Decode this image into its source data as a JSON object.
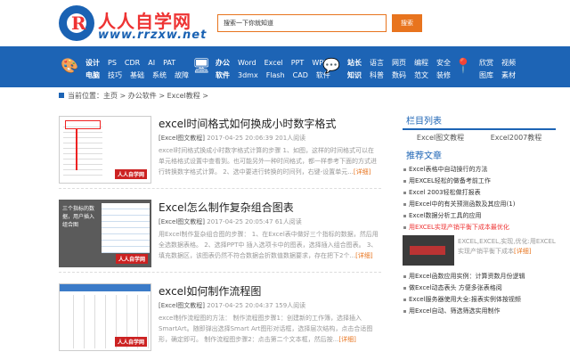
{
  "logo": {
    "mark": "R",
    "name": "人人自学网",
    "url": "www.rrzxw.net"
  },
  "search": {
    "value": "搜索一下你就知道",
    "button": "搜索"
  },
  "nav": {
    "groups": [
      {
        "icon": "palette-icon",
        "glyph": "🎨",
        "row1": [
          "设计",
          "PS",
          "CDR",
          "AI",
          "PAT"
        ],
        "row2": [
          "电脑",
          "技巧",
          "基础",
          "系统",
          "故障"
        ]
      },
      {
        "icon": "monitor-icon",
        "glyph": "🖥",
        "row1": [
          "办公",
          "Word",
          "Excel",
          "PPT",
          "WPS"
        ],
        "row2": [
          "软件",
          "3dmx",
          "Flash",
          "CAD",
          "软件"
        ]
      },
      {
        "icon": "chat-icon",
        "glyph": "💬",
        "row1": [
          "站长",
          "语言",
          "网页",
          "编程",
          "安全"
        ],
        "row2": [
          "知识",
          "科普",
          "数码",
          "范文",
          "装修"
        ]
      },
      {
        "icon": "location-icon",
        "glyph": "📍",
        "row1": [
          "欣赏",
          "视频"
        ],
        "row2": [
          "图库",
          "素材"
        ]
      }
    ]
  },
  "breadcrumb": {
    "label": "当前位置：",
    "path": "主页 > 办公软件 > Excel教程 >"
  },
  "articles": [
    {
      "title": "excel时间格式如何换成小时数字格式",
      "category": "[Excel图文教程]",
      "meta": "2017-04-25 20:06:39 201人阅读",
      "desc": "excel时间格式换成小时数字格式计算的步骤 1、如图，这样的时间格式可以在单元格格式设置中查看到。也可能另外一种时间格式，都一样参考下面的方式进行转换数字格式计算。 2、选中要进行转换的时间列，右键-设置单元...",
      "more": "[详细]",
      "badge": "人人自学网"
    },
    {
      "title": "Excel怎么制作复杂组合图表",
      "category": "[Excel图文教程]",
      "meta": "2017-04-25 20:05:47 61人阅读",
      "desc": "用Excel制作复杂组合图的步骤： 1、在Excel表中做好三个指标的数据，然后用全选数据表格。 2、选择PPT中 插入选项卡中的图表，选择插入组合图表。 3、填充数据区，该图表仍然不符合数据会折数值数据要求，存在把下2个...",
      "more": "[详细]",
      "badge": "人人自学网",
      "thumbText": "三个指标的数据，用户插入组合图"
    },
    {
      "title": "excel如何制作流程图",
      "category": "[Excel图文教程]",
      "meta": "2017-04-25 20:04:37 159人阅读",
      "desc": "excel制作流程图的方法： 制作流程图步骤1：创建新的工作簿，选择插入SmartArt。随即弹出选择Smart Art图形对话框，选择层次结构，点击合适图形，确定即可。 制作流程图步骤2：点击第二个文本框，然后按...",
      "more": "[详细]",
      "badge": "人人自学网"
    }
  ],
  "sidebar": {
    "columns_title": "栏目列表",
    "columns": [
      "Excel图文教程",
      "Excel2007教程"
    ],
    "rec_title": "推荐文章",
    "rec": [
      {
        "text": "Excel表格中自动操行的方法",
        "hot": false
      },
      {
        "text": "用EXCEL轻松的做备考前工作",
        "hot": false
      },
      {
        "text": "Excel 2003轻松做打报表",
        "hot": false
      },
      {
        "text": "用Excel中的有关预测函数及其应用(1)",
        "hot": false
      },
      {
        "text": "Excel数据分析工具的应用",
        "hot": false
      },
      {
        "text": "用EXCEL实现产销平衡下成本最优化",
        "hot": true
      }
    ],
    "feature": {
      "text": "EXCEL,EXCEL,实现,优化:用EXCEL实现产销平衡下成本",
      "more": "[详细]"
    },
    "rec2": [
      {
        "text": "用Excel函数应用实例：计算资数月份逻辑",
        "hot": false
      },
      {
        "text": "做Excel动态表头 方便多张表格阅",
        "hot": false
      },
      {
        "text": "Excel服务器使用大全:报表实例体按视频",
        "hot": false
      },
      {
        "text": "用Excel自动、筛选筛选实用制作",
        "hot": false
      }
    ]
  }
}
